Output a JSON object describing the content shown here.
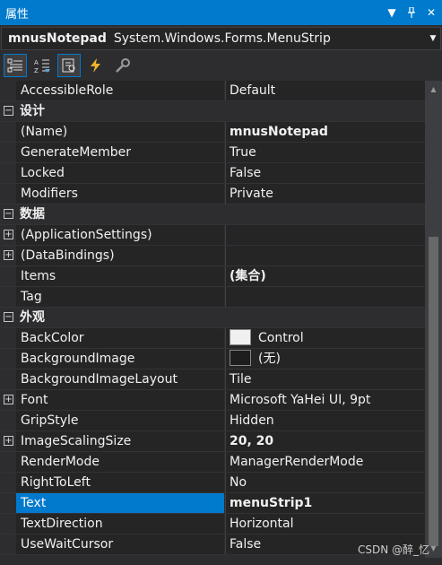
{
  "window": {
    "title": "属性"
  },
  "titlebar": {
    "dropdown_icon": "chevron-down-icon",
    "pin_icon": "pin-icon",
    "close_icon": "close-icon"
  },
  "object_selector": {
    "name": "mnusNotepad",
    "type": "System.Windows.Forms.MenuStrip"
  },
  "toolbar": {
    "buttons": [
      "categorized-icon",
      "alphabetical-icon",
      "properties-icon",
      "events-icon",
      "property-pages-icon"
    ]
  },
  "grid": {
    "rows": [
      {
        "kind": "prop",
        "name": "AccessibleRole",
        "value": "Default"
      },
      {
        "kind": "cat",
        "name": "设计",
        "expander": "⊟"
      },
      {
        "kind": "prop",
        "name": "(Name)",
        "value": "mnusNotepad",
        "bold": true
      },
      {
        "kind": "prop",
        "name": "GenerateMember",
        "value": "True"
      },
      {
        "kind": "prop",
        "name": "Locked",
        "value": "False"
      },
      {
        "kind": "prop",
        "name": "Modifiers",
        "value": "Private"
      },
      {
        "kind": "cat",
        "name": "数据",
        "expander": "⊟"
      },
      {
        "kind": "prop",
        "name": "(ApplicationSettings)",
        "value": "",
        "expander": "+"
      },
      {
        "kind": "prop",
        "name": "(DataBindings)",
        "value": "",
        "expander": "+"
      },
      {
        "kind": "prop",
        "name": "Items",
        "value": "(集合)",
        "bold": true
      },
      {
        "kind": "prop",
        "name": "Tag",
        "value": ""
      },
      {
        "kind": "cat",
        "name": "外观",
        "expander": "⊟"
      },
      {
        "kind": "prop",
        "name": "BackColor",
        "value": "Control",
        "swatch": "#f0f0f0"
      },
      {
        "kind": "prop",
        "name": "BackgroundImage",
        "value": "(无)",
        "swatch": "#1e1e1e"
      },
      {
        "kind": "prop",
        "name": "BackgroundImageLayout",
        "value": "Tile"
      },
      {
        "kind": "prop",
        "name": "Font",
        "value": "Microsoft YaHei UI, 9pt",
        "expander": "+"
      },
      {
        "kind": "prop",
        "name": "GripStyle",
        "value": "Hidden"
      },
      {
        "kind": "prop",
        "name": "ImageScalingSize",
        "value": "20, 20",
        "bold": true,
        "expander": "+"
      },
      {
        "kind": "prop",
        "name": "RenderMode",
        "value": "ManagerRenderMode"
      },
      {
        "kind": "prop",
        "name": "RightToLeft",
        "value": "No"
      },
      {
        "kind": "prop",
        "name": "Text",
        "value": "menuStrip1",
        "bold": true,
        "selected": true
      },
      {
        "kind": "prop",
        "name": "TextDirection",
        "value": "Horizontal"
      },
      {
        "kind": "prop",
        "name": "UseWaitCursor",
        "value": "False"
      }
    ]
  },
  "watermark": "CSDN @醉_忆",
  "colors": {
    "accent": "#007acc",
    "background": "#2d2d30",
    "cell": "#252526"
  }
}
